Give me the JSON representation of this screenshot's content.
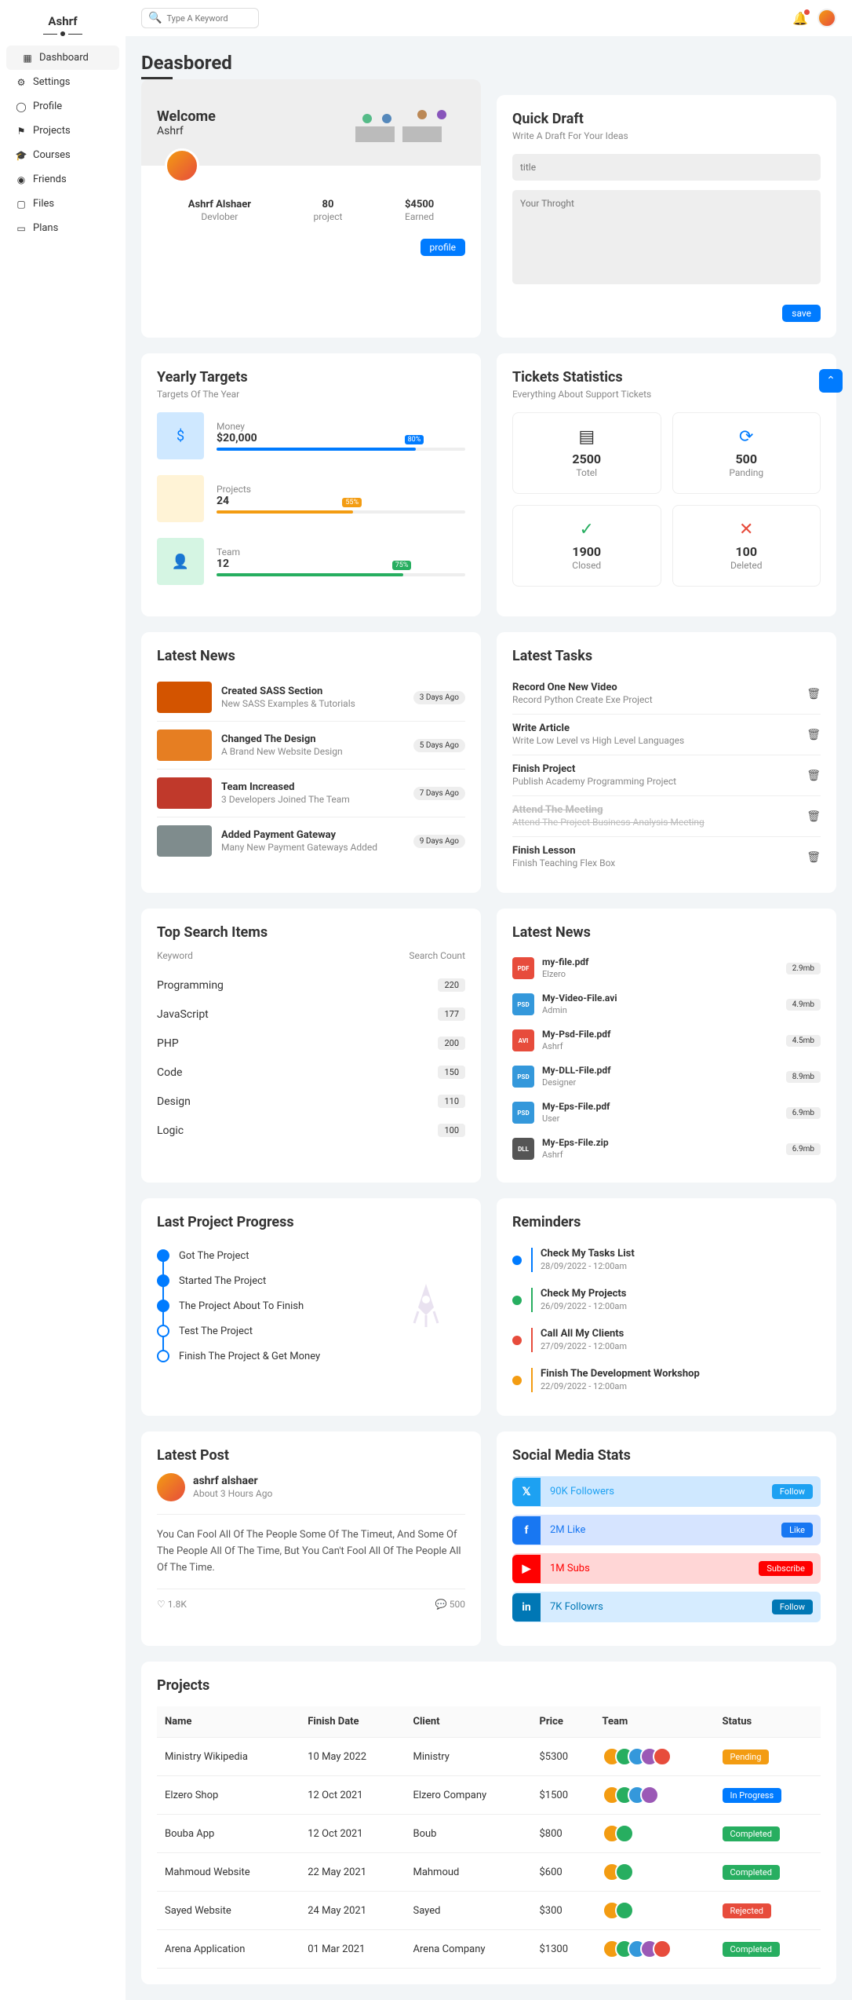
{
  "brand": "Ashrf",
  "search_placeholder": "Type A Keyword",
  "nav": [
    {
      "icon": "▦",
      "label": "Dashboard"
    },
    {
      "icon": "⚙",
      "label": "Settings"
    },
    {
      "icon": "◯",
      "label": "Profile"
    },
    {
      "icon": "⚑",
      "label": "Projects"
    },
    {
      "icon": "🎓",
      "label": "Courses"
    },
    {
      "icon": "◉",
      "label": "Friends"
    },
    {
      "icon": "▢",
      "label": "Files"
    },
    {
      "icon": "▭",
      "label": "Plans"
    }
  ],
  "page_title": "Deasbored",
  "welcome": {
    "title": "Welcome",
    "name": "Ashrf",
    "stats": [
      {
        "value": "Ashrf Alshaer",
        "label": "Devlober"
      },
      {
        "value": "80",
        "label": "project"
      },
      {
        "value": "$4500",
        "label": "Earned"
      }
    ],
    "button": "profile"
  },
  "quick_draft": {
    "title": "Quick Draft",
    "sub": "Write A Draft For Your Ideas",
    "title_ph": "title",
    "body_ph": "Your Throght",
    "button": "save"
  },
  "yearly": {
    "title": "Yearly Targets",
    "sub": "Targets Of The Year",
    "items": [
      {
        "icon": "$",
        "cls": "ti-blue",
        "color": "#007bff",
        "label": "Money",
        "value": "$20,000",
        "pct": "80%",
        "pctw": "80%"
      },
      {
        "icon": "</>",
        "cls": "ti-orange",
        "color": "#f39c12",
        "label": "Projects",
        "value": "24",
        "pct": "55%",
        "pctw": "55%"
      },
      {
        "icon": "👤",
        "cls": "ti-green",
        "color": "#27ae60",
        "label": "Team",
        "value": "12",
        "pct": "75%",
        "pctw": "75%"
      }
    ]
  },
  "tickets": {
    "title": "Tickets Statistics",
    "sub": "Everything About Support Tickets",
    "items": [
      {
        "icon": "▤",
        "color": "#333",
        "value": "2500",
        "label": "Totel"
      },
      {
        "icon": "⟳",
        "color": "#007bff",
        "value": "500",
        "label": "Panding"
      },
      {
        "icon": "✓",
        "color": "#27ae60",
        "value": "1900",
        "label": "Closed"
      },
      {
        "icon": "✕",
        "color": "#e74c3c",
        "value": "100",
        "label": "Deleted"
      }
    ]
  },
  "latest_news": {
    "title": "Latest News",
    "items": [
      {
        "img": "#d35400",
        "title": "Created SASS Section",
        "sub": "New SASS Examples & Tutorials",
        "days": "3 Days Ago"
      },
      {
        "img": "#e67e22",
        "title": "Changed The Design",
        "sub": "A Brand New Website Design",
        "days": "5 Days Ago"
      },
      {
        "img": "#c0392b",
        "title": "Team Increased",
        "sub": "3 Developers Joined The Team",
        "days": "7 Days Ago"
      },
      {
        "img": "#7f8c8d",
        "title": "Added Payment Gateway",
        "sub": "Many New Payment Gateways Added",
        "days": "9 Days Ago"
      }
    ]
  },
  "latest_tasks": {
    "title": "Latest Tasks",
    "items": [
      {
        "title": "Record One New Video",
        "sub": "Record Python Create Exe Project",
        "done": false
      },
      {
        "title": "Write Article",
        "sub": "Write Low Level vs High Level Languages",
        "done": false
      },
      {
        "title": "Finish Project",
        "sub": "Publish Academy Programming Project",
        "done": false
      },
      {
        "title": "Attend The Meeting",
        "sub": "Attend The Project Business Analysis Meeting",
        "done": true
      },
      {
        "title": "Finish Lesson",
        "sub": "Finish Teaching Flex Box",
        "done": false
      }
    ]
  },
  "top_search": {
    "title": "Top Search Items",
    "head_k": "Keyword",
    "head_c": "Search Count",
    "items": [
      {
        "k": "Programming",
        "c": "220"
      },
      {
        "k": "JavaScript",
        "c": "177"
      },
      {
        "k": "PHP",
        "c": "200"
      },
      {
        "k": "Code",
        "c": "150"
      },
      {
        "k": "Design",
        "c": "110"
      },
      {
        "k": "Logic",
        "c": "100"
      }
    ]
  },
  "files": {
    "title": "Latest News",
    "items": [
      {
        "ext": "PDF",
        "color": "#e74c3c",
        "name": "my-file.pdf",
        "by": "Elzero",
        "size": "2.9mb"
      },
      {
        "ext": "PSD",
        "color": "#3498db",
        "name": "My-Video-File.avi",
        "by": "Admin",
        "size": "4.9mb"
      },
      {
        "ext": "AVI",
        "color": "#e74c3c",
        "name": "My-Psd-File.pdf",
        "by": "Ashrf",
        "size": "4.5mb"
      },
      {
        "ext": "PSD",
        "color": "#3498db",
        "name": "My-DLL-File.pdf",
        "by": "Designer",
        "size": "8.9mb"
      },
      {
        "ext": "PSD",
        "color": "#3498db",
        "name": "My-Eps-File.pdf",
        "by": "User",
        "size": "6.9mb"
      },
      {
        "ext": "DLL",
        "color": "#555",
        "name": "My-Eps-File.zip",
        "by": "Ashrf",
        "size": "6.9mb"
      }
    ]
  },
  "project_progress": {
    "title": "Last Project Progress",
    "steps": [
      {
        "label": "Got The Project",
        "filled": true
      },
      {
        "label": "Started The Project",
        "filled": true
      },
      {
        "label": "The Project About To Finish",
        "filled": true
      },
      {
        "label": "Test The Project",
        "filled": false
      },
      {
        "label": "Finish The Project & Get Money",
        "filled": false
      }
    ]
  },
  "reminders": {
    "title": "Reminders",
    "items": [
      {
        "color": "#007bff",
        "title": "Check My Tasks List",
        "sub": "28/09/2022 - 12:00am"
      },
      {
        "color": "#27ae60",
        "title": "Check My Projects",
        "sub": "26/09/2022 - 12:00am"
      },
      {
        "color": "#e74c3c",
        "title": "Call All My Clients",
        "sub": "27/09/2022 - 12:00am"
      },
      {
        "color": "#f39c12",
        "title": "Finish The Development Workshop",
        "sub": "22/09/2022 - 12:00am"
      }
    ]
  },
  "post": {
    "title": "Latest Post",
    "author": "ashrf alshaer",
    "time": "About 3 Hours Ago",
    "body": "You Can Fool All Of The People Some Of The Timeut, And Some Of The People All Of The Time, But You Can't Fool All Of The People All Of The Time.",
    "likes": "1.8K",
    "comments": "500"
  },
  "social": {
    "title": "Social Media Stats",
    "items": [
      {
        "icon": "𝕏",
        "bg": "#cfe8ff",
        "iconbg": "#1da1f2",
        "txt": "90K Followers",
        "btn": "Follow",
        "btnbg": "#1da1f2"
      },
      {
        "icon": "f",
        "bg": "#d6e4ff",
        "iconbg": "#1877f2",
        "txt": "2M Like",
        "btn": "Like",
        "btnbg": "#1877f2"
      },
      {
        "icon": "▶",
        "bg": "#ffd6d6",
        "iconbg": "#ff0000",
        "txt": "1M Subs",
        "btn": "Subscribe",
        "btnbg": "#ff0000"
      },
      {
        "icon": "in",
        "bg": "#d6ecff",
        "iconbg": "#0077b5",
        "txt": "7K Followrs",
        "btn": "Follow",
        "btnbg": "#0077b5"
      }
    ]
  },
  "projects": {
    "title": "Projects",
    "headers": [
      "Name",
      "Finish Date",
      "Client",
      "Price",
      "Team",
      "Status"
    ],
    "rows": [
      {
        "name": "Ministry Wikipedia",
        "date": "10 May 2022",
        "client": "Ministry",
        "price": "$5300",
        "team": 5,
        "status": "Pending",
        "color": "#f39c12"
      },
      {
        "name": "Elzero Shop",
        "date": "12 Oct 2021",
        "client": "Elzero Company",
        "price": "$1500",
        "team": 4,
        "status": "In Progress",
        "color": "#007bff"
      },
      {
        "name": "Bouba App",
        "date": "12 Oct 2021",
        "client": "Boub",
        "price": "$800",
        "team": 2,
        "status": "Completed",
        "color": "#27ae60"
      },
      {
        "name": "Mahmoud Website",
        "date": "22 May 2021",
        "client": "Mahmoud",
        "price": "$600",
        "team": 2,
        "status": "Completed",
        "color": "#27ae60"
      },
      {
        "name": "Sayed Website",
        "date": "24 May 2021",
        "client": "Sayed",
        "price": "$300",
        "team": 2,
        "status": "Rejected",
        "color": "#e74c3c"
      },
      {
        "name": "Arena Application",
        "date": "01 Mar 2021",
        "client": "Arena Company",
        "price": "$1300",
        "team": 5,
        "status": "Completed",
        "color": "#27ae60"
      }
    ]
  },
  "av_colors": [
    "#f39c12",
    "#27ae60",
    "#3498db",
    "#9b59b6",
    "#e74c3c"
  ]
}
